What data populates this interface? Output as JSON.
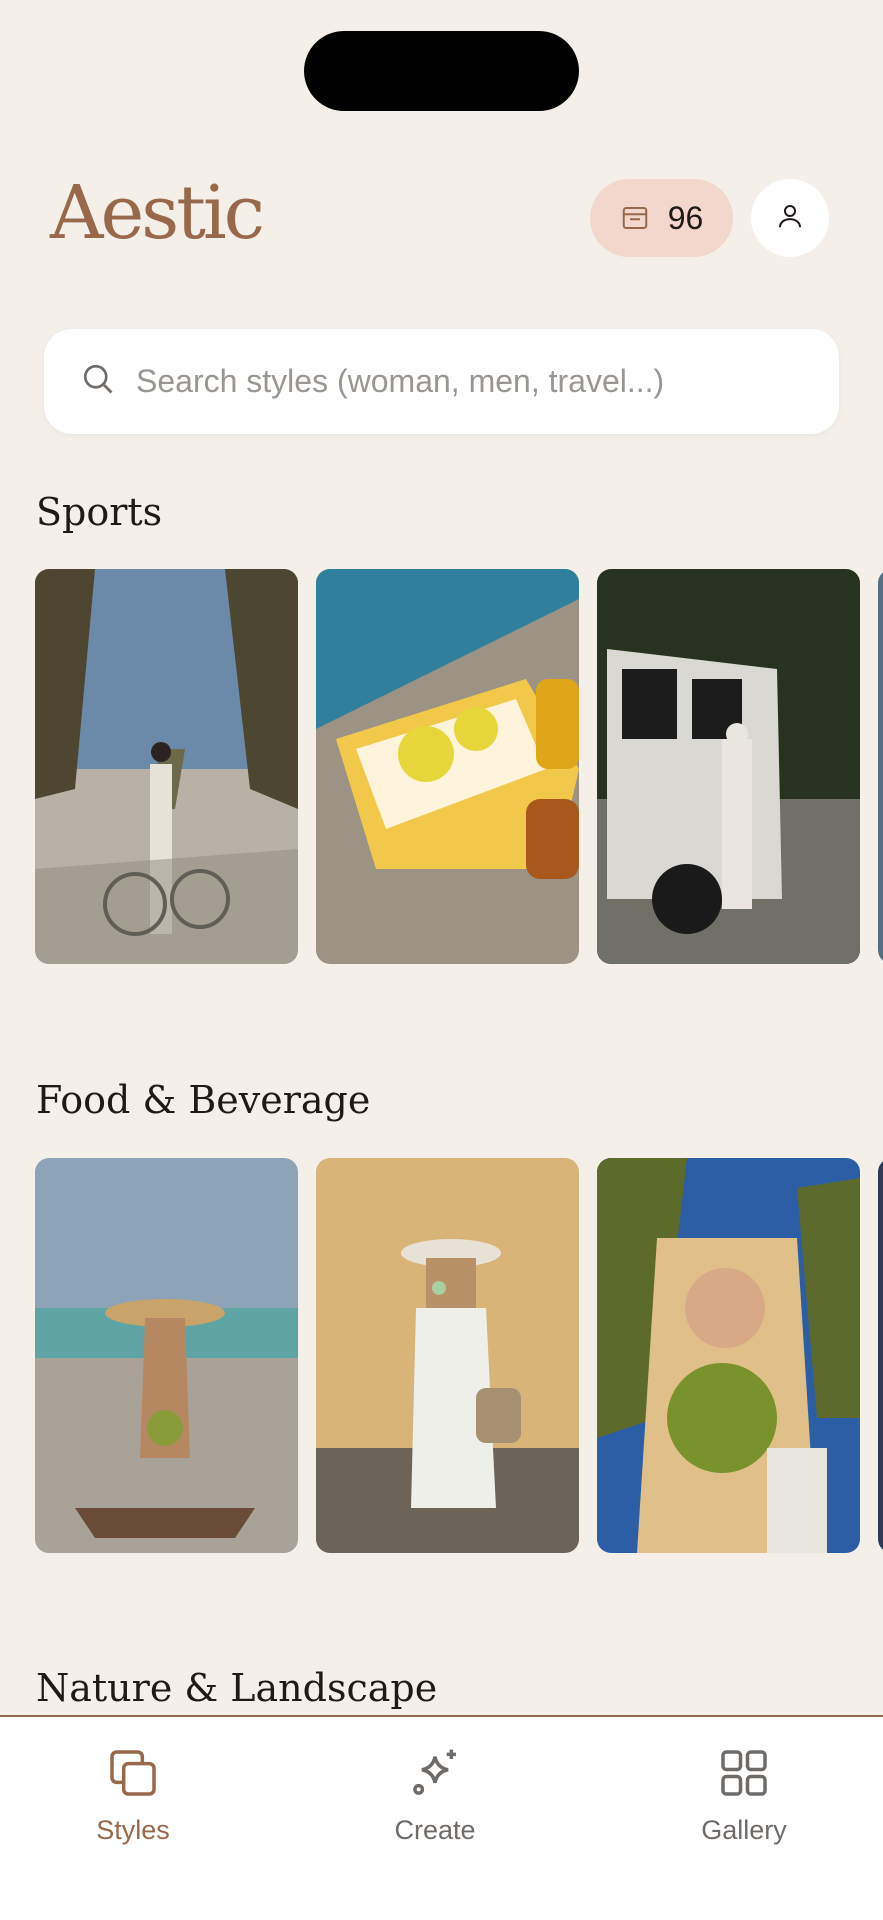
{
  "app": {
    "name": "Aestic"
  },
  "header": {
    "credits": "96",
    "credits_icon": "wallet-icon",
    "profile_icon": "user-icon"
  },
  "search": {
    "placeholder": "Search styles (woman, men, travel...)",
    "icon": "search-icon"
  },
  "sections": [
    {
      "title": "Sports",
      "images": [
        "woman with bicycle on palm avenue",
        "towel and lemonade drinks by pool",
        "woman beside white SUV under palms"
      ]
    },
    {
      "title": "Food & Beverage",
      "images": [
        "woman in straw hat on beach with coconut",
        "woman in white dress eating ice cream",
        "woman drinking from green coconut"
      ]
    },
    {
      "title": "Nature & Landscape"
    }
  ],
  "nav": {
    "items": [
      {
        "label": "Styles",
        "icon": "styles-icon",
        "active": true
      },
      {
        "label": "Create",
        "icon": "sparkle-icon",
        "active": false
      },
      {
        "label": "Gallery",
        "icon": "grid-icon",
        "active": false
      }
    ]
  },
  "colors": {
    "background": "#f4efe9",
    "accent": "#98684a",
    "credits_bg": "#f3d6cc",
    "nav_inactive": "#6f6b68"
  }
}
